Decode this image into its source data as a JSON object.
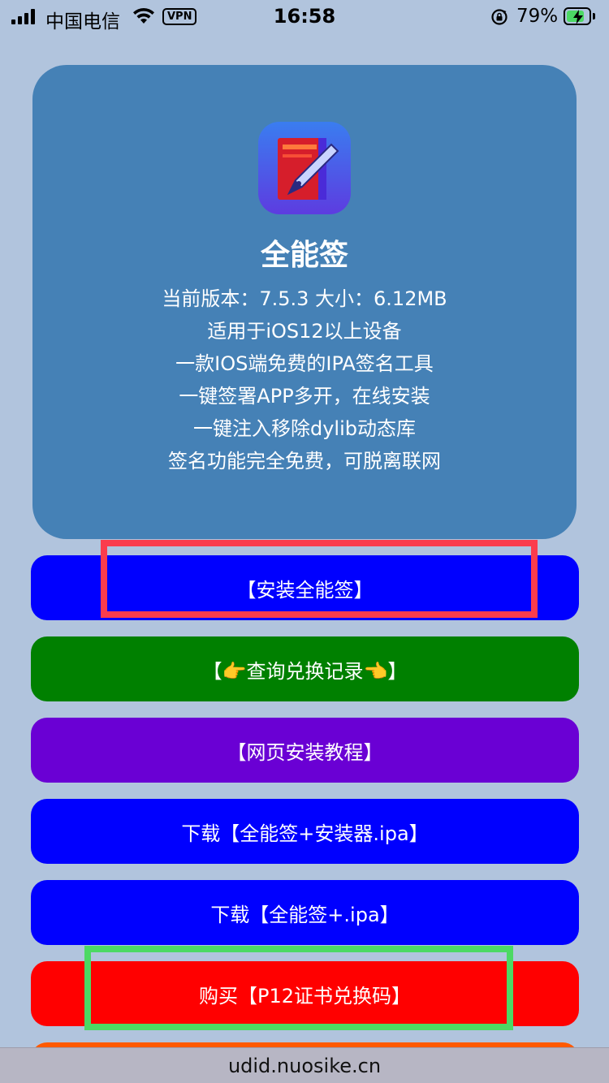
{
  "status_bar": {
    "carrier": "中国电信",
    "vpn": "VPN",
    "time": "16:58",
    "battery_percent": "79%",
    "battery_level": 0.79
  },
  "card": {
    "app_name": "全能签",
    "lines": [
      "当前版本：7.5.3   大小：6.12MB",
      "适用于iOS12以上设备",
      "一款IOS端免费的IPA签名工具",
      "一键签署APP多开，在线安装",
      "一键注入移除dylib动态库",
      "签名功能完全免费，可脱离联网"
    ],
    "background": "#4581b6"
  },
  "buttons": [
    {
      "label": "【安装全能签】",
      "color": "#0000ff"
    },
    {
      "label": "【👉查询兑换记录👈】",
      "color": "#008000"
    },
    {
      "label": "【网页安装教程】",
      "color": "#6a00d4"
    },
    {
      "label": "下载【全能签+安装器.ipa】",
      "color": "#0000ff"
    },
    {
      "label": "下载【全能签+.ipa】",
      "color": "#0000ff"
    },
    {
      "label": "购买【P12证书兑换码】",
      "color": "#ff0000"
    }
  ],
  "url_bar": {
    "url": "udid.nuosike.cn"
  }
}
